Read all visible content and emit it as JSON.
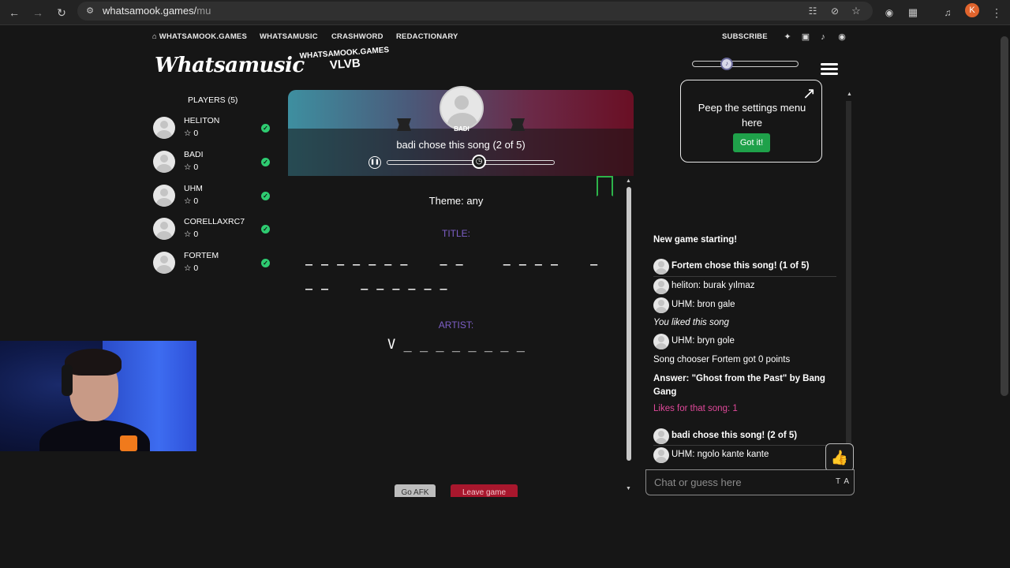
{
  "browser": {
    "url_host": "whatsamook.games/",
    "url_path": "mu",
    "profile_initial": "K"
  },
  "nav": {
    "home": "WHATSAMOOK.GAMES",
    "links": [
      "WHATSAMUSIC",
      "CRASHWORD",
      "REDACTIONARY"
    ],
    "subscribe": "SUBSCRIBE",
    "socials": [
      "twitter-icon",
      "instagram-icon",
      "tiktok-icon",
      "discord-icon"
    ]
  },
  "logo": "Whatsamusic",
  "room": {
    "site": "WHATSAMOOK.GAMES",
    "code": "VLVB"
  },
  "players": {
    "title": "PLAYERS (5)",
    "list": [
      {
        "name": "HELITON",
        "score": "0"
      },
      {
        "name": "BADI",
        "score": "0"
      },
      {
        "name": "UHM",
        "score": "0"
      },
      {
        "name": "CORELLAXRC7",
        "score": "0"
      },
      {
        "name": "FORTEM",
        "score": "0"
      }
    ]
  },
  "song": {
    "chooser": "BADI",
    "status": "badi chose this song (2 of 5)",
    "progress": 0.55
  },
  "puzzle": {
    "theme": "Theme: any",
    "title_label": "TITLE:",
    "title_line1": "_ _ _ _ _ _ _    _ _     _ _ _ _    _",
    "title_line2": "_ _    _ _ _ _ _ _",
    "artist_label": "ARTIST:",
    "artist_hint": "V _ _ _ _ _ _ _ _"
  },
  "buttons": {
    "go_afk": "Go AFK",
    "leave_game": "Leave game"
  },
  "settings_tip": {
    "text": "Peep the settings menu here",
    "button": "Got it!"
  },
  "chat": {
    "new_game": "New game starting!",
    "chose1": "Fortem chose this song! (1 of 5)",
    "msg1": "heliton: burak yılmaz",
    "msg2": "UHM: bron gale",
    "liked": "You liked this song",
    "msg3": "UHM: bryn gole",
    "chooser_points": "Song chooser Fortem got 0 points",
    "answer": "Answer: \"Ghost from the Past\" by Bang Gang",
    "likes": "Likes for that song: 1",
    "chose2": "badi chose this song! (2 of 5)",
    "msg4": "UHM: ngolo kante kante",
    "placeholder": "Chat or guess here",
    "ta": "TA"
  },
  "colors": {
    "accent_green": "#1fa14a",
    "label_purple": "#7d5fc7",
    "leave_red": "#a8172d",
    "likes_pink": "#e0489a"
  }
}
